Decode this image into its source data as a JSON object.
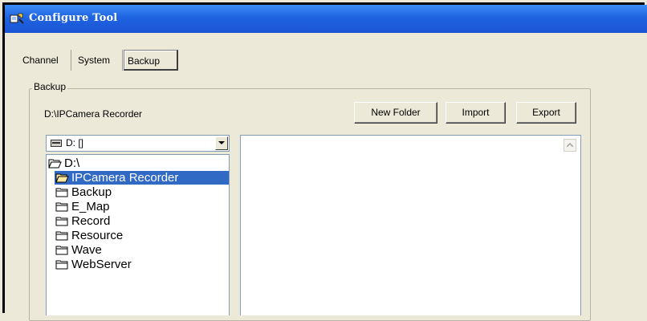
{
  "window": {
    "title": "Configure Tool"
  },
  "tabs": [
    {
      "label": "Channel"
    },
    {
      "label": "System"
    },
    {
      "label": "Backup",
      "active": true
    }
  ],
  "backup": {
    "group_label": "Backup",
    "current_path": "D:\\IPCamera Recorder",
    "buttons": {
      "new_folder": "New Folder",
      "import": "Import",
      "export": "Export"
    },
    "drive_select": {
      "value": "D: []"
    },
    "tree": [
      {
        "label": "D:\\",
        "icon": "open-folder-icon"
      },
      {
        "label": "IPCamera Recorder",
        "icon": "open-folder-icon",
        "selected": true
      },
      {
        "label": "Backup",
        "icon": "folder-icon"
      },
      {
        "label": "E_Map",
        "icon": "folder-icon"
      },
      {
        "label": "Record",
        "icon": "folder-icon"
      },
      {
        "label": "Resource",
        "icon": "folder-icon"
      },
      {
        "label": "Wave",
        "icon": "folder-icon"
      },
      {
        "label": "WebServer",
        "icon": "folder-icon"
      }
    ]
  },
  "colors": {
    "titlebar": "#1f63e0",
    "selection": "#316AC5",
    "face": "#ECE9D8"
  }
}
